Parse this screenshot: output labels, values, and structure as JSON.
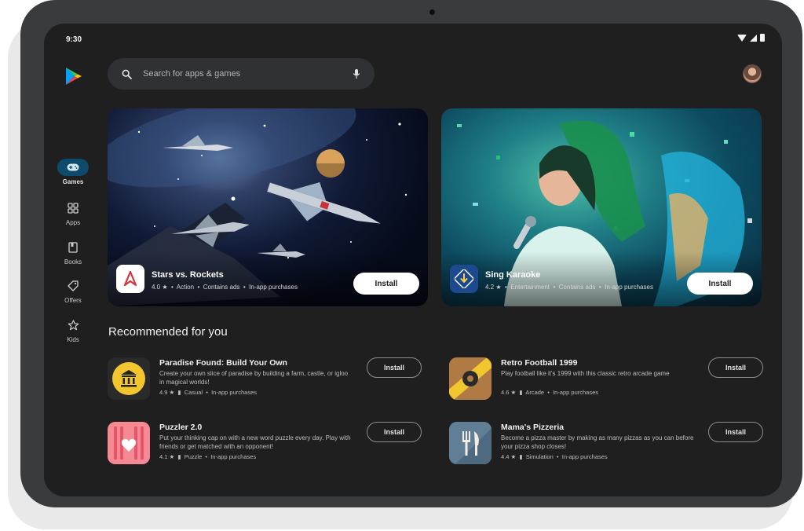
{
  "status_bar": {
    "time": "9:30"
  },
  "search": {
    "placeholder": "Search for apps & games"
  },
  "nav": [
    {
      "label": "Games",
      "icon": "gamepad-icon"
    },
    {
      "label": "Apps",
      "icon": "apps-grid-icon"
    },
    {
      "label": "Books",
      "icon": "book-icon"
    },
    {
      "label": "Offers",
      "icon": "tag-icon"
    },
    {
      "label": "Kids",
      "icon": "star-icon"
    }
  ],
  "featured": [
    {
      "title": "Stars vs. Rockets",
      "rating": "4.0",
      "category": "Action",
      "tags": "Contains ads",
      "purchases": "In-app purchases",
      "install_label": "Install"
    },
    {
      "title": "Sing Karaoke",
      "rating": "4.2",
      "category": "Entertainment",
      "tags": "Contains ads",
      "purchases": "In-app purchases",
      "install_label": "Install"
    }
  ],
  "section_title": "Recommended for you",
  "recommended": [
    {
      "title": "Paradise Found: Build Your Own",
      "description": "Create your own slice of paradise by building a farm, castle, or igloo in magical worlds!",
      "rating": "4.9",
      "category": "Casual",
      "purchases": "In-app purchases",
      "install_label": "Install"
    },
    {
      "title": "Retro Football 1999",
      "description": "Play football like it's 1999 with this classic retro arcade game",
      "rating": "4.6",
      "category": "Arcade",
      "purchases": "In-app purchases",
      "install_label": "Install"
    },
    {
      "title": "Puzzler 2.0",
      "description": "Put your thinking cap on with a new word puzzle every day. Play with friends or get matched with an opponent!",
      "rating": "4.1",
      "category": "Puzzle",
      "purchases": "In-app purchases",
      "install_label": "Install"
    },
    {
      "title": "Mama's Pizzeria",
      "description": "Become a pizza master by making as many pizzas as you can before your pizza shop closes!",
      "rating": "4.4",
      "category": "Simulation",
      "purchases": "In-app purchases",
      "install_label": "Install"
    }
  ],
  "colors": {
    "screen_bg": "#1f1f1f",
    "nav_active": "#0e4a6b",
    "search_bg": "#303134"
  }
}
